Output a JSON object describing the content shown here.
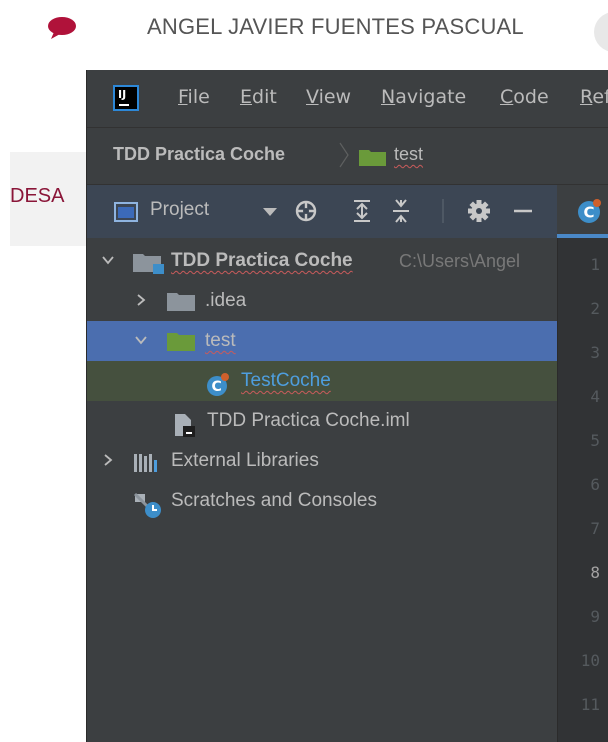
{
  "web": {
    "user_name": "ANGEL JAVIER FUENTES PASCUAL",
    "side_label": "DESA",
    "accent_color": "#8a1538"
  },
  "ide": {
    "menu": [
      {
        "accel": "F",
        "rest": "ile"
      },
      {
        "accel": "E",
        "rest": "dit"
      },
      {
        "accel": "V",
        "rest": "iew"
      },
      {
        "accel": "N",
        "rest": "avigate"
      },
      {
        "accel": "C",
        "rest": "ode"
      },
      {
        "accel": "R",
        "rest": "efactor"
      }
    ],
    "app_logo_text": "IJ",
    "breadcrumb": {
      "project": "TDD Practica Coche",
      "folder": "test"
    },
    "toolbar": {
      "view_label": "Project"
    },
    "tree": {
      "root_label": "TDD Practica Coche",
      "root_path": "C:\\Users\\Angel",
      "idea_label": ".idea",
      "test_label": "test",
      "testcoche_label": "TestCoche",
      "iml_label": "TDD Practica Coche.iml",
      "ext_libs_label": "External Libraries",
      "scratches_label": "Scratches and Consoles"
    },
    "line_numbers": [
      "1",
      "2",
      "3",
      "4",
      "5",
      "6",
      "7",
      "8",
      "9",
      "10",
      "11"
    ],
    "active_line": "8",
    "colors": {
      "background": "#3c3f41",
      "selection": "#4b6eaf",
      "highlight": "#45503e",
      "folder_green": "#6a9a3a",
      "link_blue": "#4e9ede"
    }
  }
}
